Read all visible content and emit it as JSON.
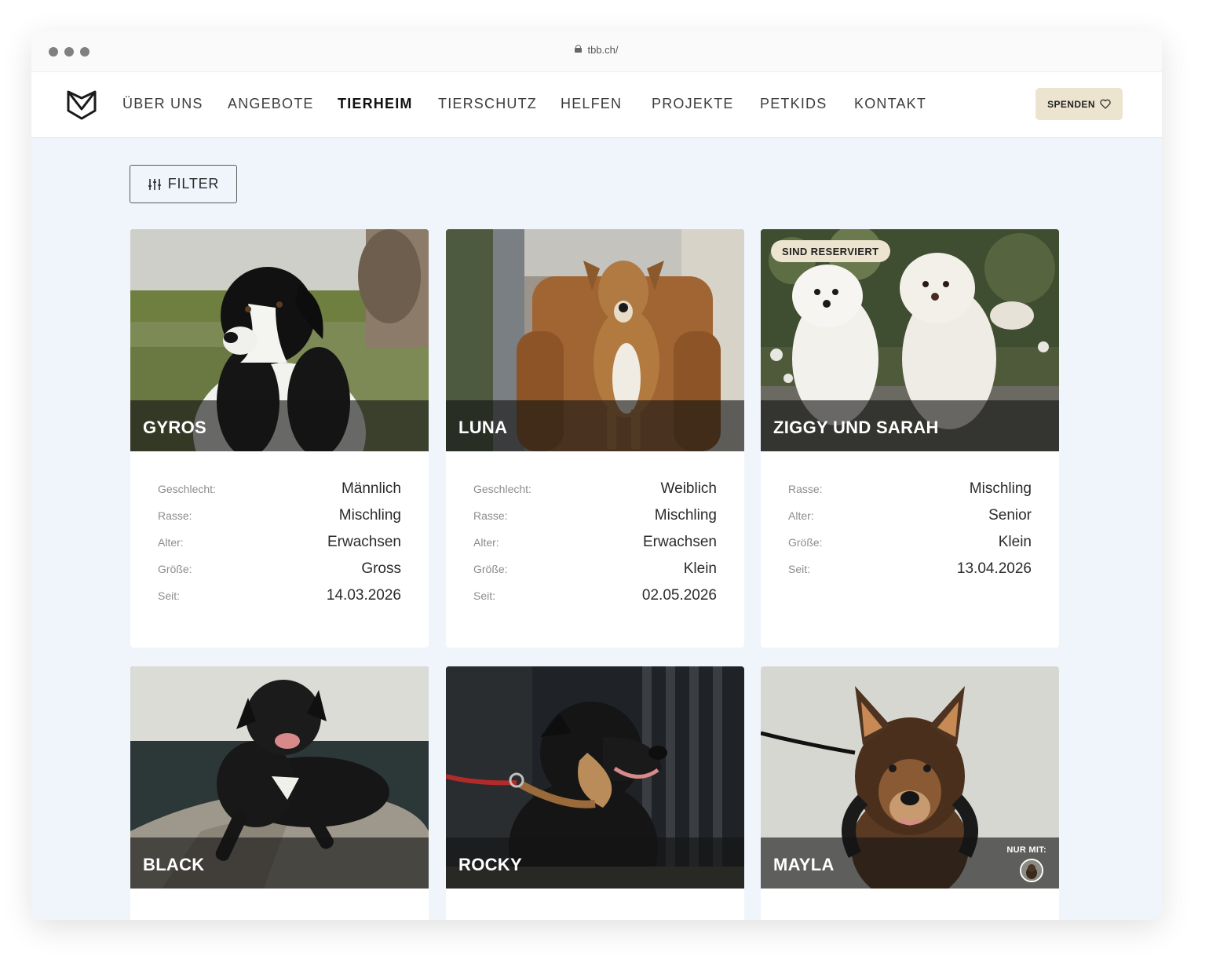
{
  "browser": {
    "url": "tbb.ch/"
  },
  "nav": {
    "items": [
      {
        "label": "ÜBER UNS",
        "active": false
      },
      {
        "label": "ANGEBOTE",
        "active": false
      },
      {
        "label": "TIERHEIM",
        "active": true
      },
      {
        "label": "TIERSCHUTZ",
        "active": false
      },
      {
        "label": "HELFEN",
        "active": false
      },
      {
        "label": "PROJEKTE",
        "active": false
      },
      {
        "label": "PETKIDS",
        "active": false
      },
      {
        "label": "KONTAKT",
        "active": false
      }
    ],
    "donate_label": "SPENDEN"
  },
  "filter": {
    "label": "FILTER"
  },
  "animals": [
    {
      "name": "GYROS",
      "details": [
        {
          "label": "Geschlecht:",
          "value": "Männlich"
        },
        {
          "label": "Rasse:",
          "value": "Mischling"
        },
        {
          "label": "Alter:",
          "value": "Erwachsen"
        },
        {
          "label": "Größe:",
          "value": "Gross"
        },
        {
          "label": "Seit:",
          "value": "14.03.2026"
        }
      ]
    },
    {
      "name": "LUNA",
      "details": [
        {
          "label": "Geschlecht:",
          "value": "Weiblich"
        },
        {
          "label": "Rasse:",
          "value": "Mischling"
        },
        {
          "label": "Alter:",
          "value": "Erwachsen"
        },
        {
          "label": "Größe:",
          "value": "Klein"
        },
        {
          "label": "Seit:",
          "value": "02.05.2026"
        }
      ]
    },
    {
      "name": "ZIGGY UND SARAH",
      "badge": "SIND RESERVIERT",
      "details": [
        {
          "label": "Rasse:",
          "value": "Mischling"
        },
        {
          "label": "Alter:",
          "value": "Senior"
        },
        {
          "label": "Größe:",
          "value": "Klein"
        },
        {
          "label": "Seit:",
          "value": "13.04.2026"
        }
      ]
    },
    {
      "name": "BLACK"
    },
    {
      "name": "ROCKY"
    },
    {
      "name": "MAYLA",
      "nur_mit_label": "NUR MIT:"
    }
  ],
  "colors": {
    "page_bg": "#f0f4fb",
    "accent_beige": "#ece4cf",
    "name_bar": "#141414"
  }
}
